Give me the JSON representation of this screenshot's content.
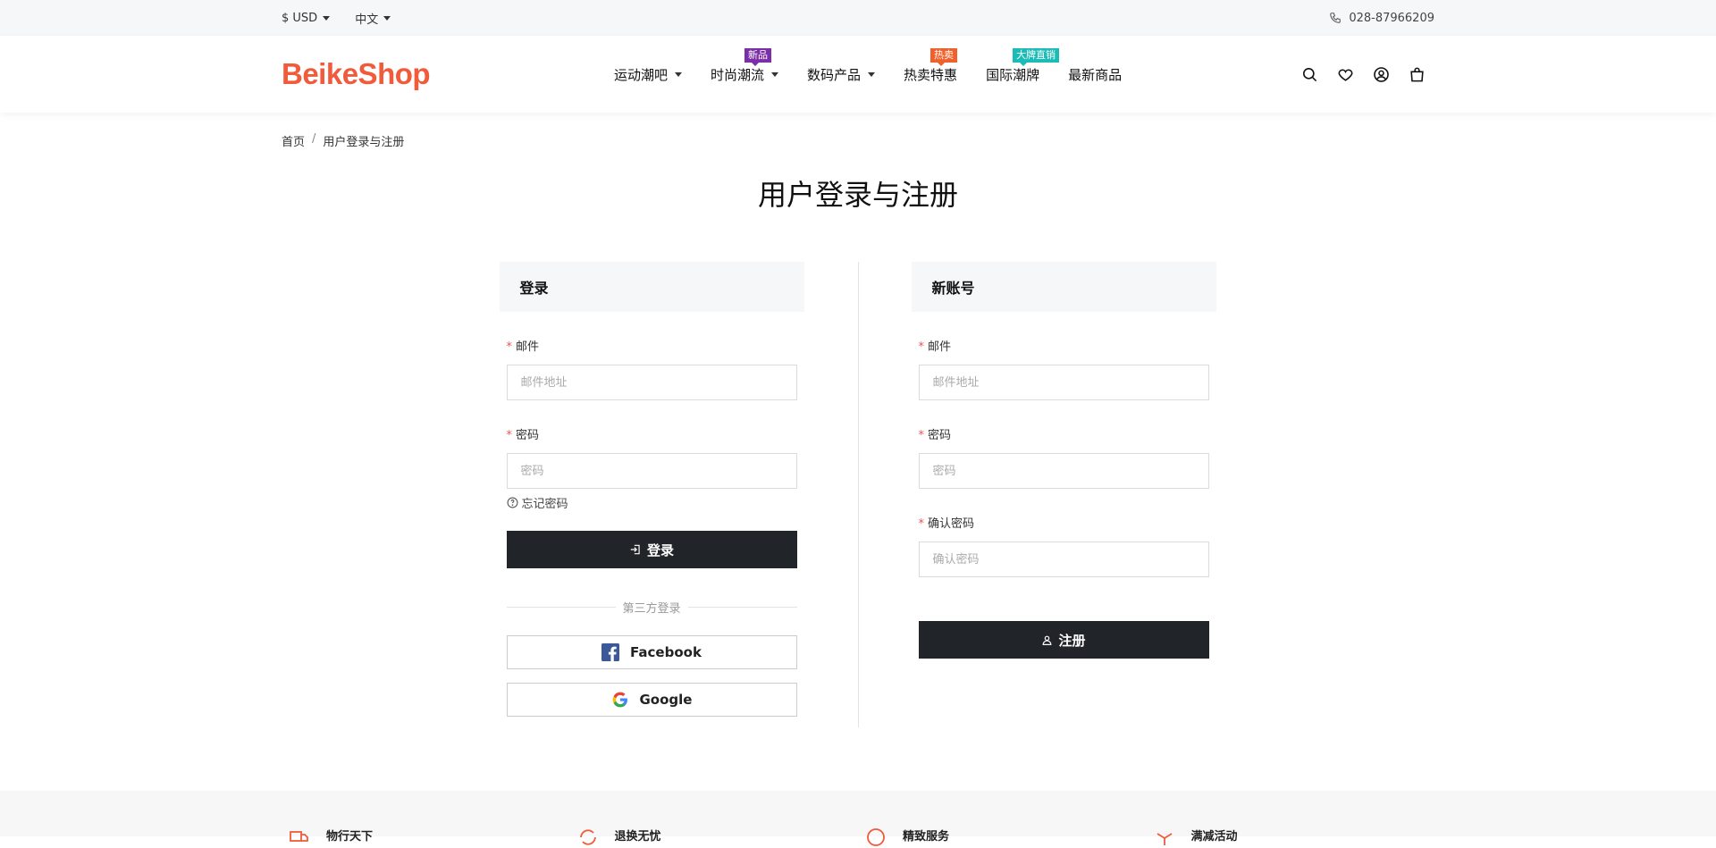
{
  "topbar": {
    "currency": "$ USD",
    "language": "中文",
    "phone": "028-87966209"
  },
  "header": {
    "logo": "BeikeShop",
    "nav": [
      {
        "label": "运动潮吧",
        "dropdown": true,
        "badge": null
      },
      {
        "label": "时尚潮流",
        "dropdown": true,
        "badge": "新品",
        "badge_color": "#7b2ea8"
      },
      {
        "label": "数码产品",
        "dropdown": true,
        "badge": null
      },
      {
        "label": "热卖特惠",
        "dropdown": false,
        "badge": "热卖",
        "badge_color": "#f0602a"
      },
      {
        "label": "国际潮牌",
        "dropdown": false,
        "badge": "大牌直销",
        "badge_color": "#1bbcb6"
      },
      {
        "label": "最新商品",
        "dropdown": false,
        "badge": null
      }
    ],
    "icons": [
      "search-icon",
      "heart-icon",
      "user-icon",
      "bag-icon"
    ]
  },
  "breadcrumb": {
    "home": "首页",
    "separator": "/",
    "current": "用户登录与注册"
  },
  "page_title": "用户登录与注册",
  "login": {
    "heading": "登录",
    "email_label": "邮件",
    "email_placeholder": "邮件地址",
    "password_label": "密码",
    "password_placeholder": "密码",
    "forgot": "忘记密码",
    "submit": "登录",
    "third_party": "第三方登录",
    "facebook": "Facebook",
    "google": "Google"
  },
  "register": {
    "heading": "新账号",
    "email_label": "邮件",
    "email_placeholder": "邮件地址",
    "password_label": "密码",
    "password_placeholder": "密码",
    "confirm_label": "确认密码",
    "confirm_placeholder": "确认密码",
    "submit": "注册"
  },
  "footer": {
    "features": [
      "物行天下",
      "退换无忧",
      "精致服务",
      "满减活动"
    ]
  },
  "colors": {
    "brand": "#f15a3a",
    "dark_button": "#212429",
    "required": "#e55555"
  }
}
